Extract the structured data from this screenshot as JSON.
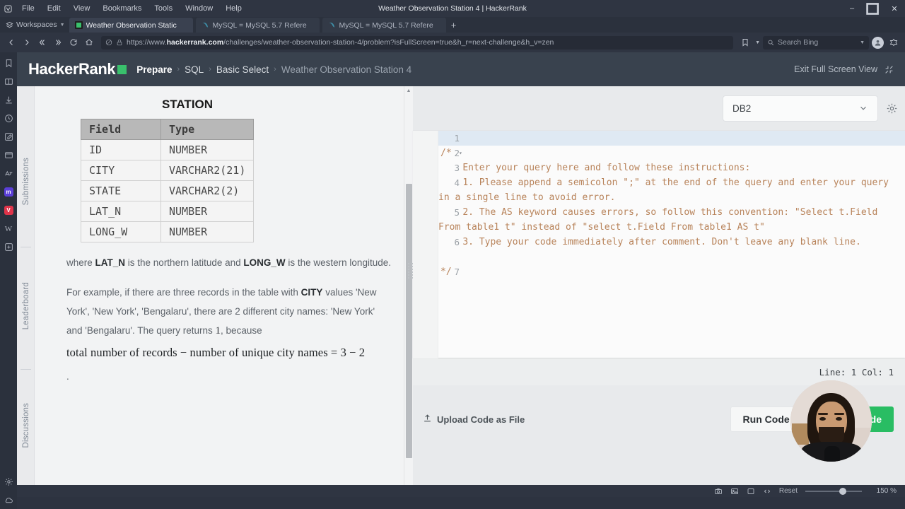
{
  "browser": {
    "menu_items": [
      "File",
      "Edit",
      "View",
      "Bookmarks",
      "Tools",
      "Window",
      "Help"
    ],
    "window_title": "Weather Observation Station 4 | HackerRank",
    "window_controls": {
      "minimize": "–",
      "maximize": "❐",
      "close": "✕"
    },
    "workspaces_label": "Workspaces",
    "tabs": [
      {
        "title": "Weather Observation Static",
        "favicon": "hackerrank-icon",
        "active": true
      },
      {
        "title": "MySQL = MySQL 5.7 Refere",
        "favicon": "mysql-icon",
        "active": false
      },
      {
        "title": "MySQL = MySQL 5.7 Refere",
        "favicon": "mysql-icon",
        "active": false
      }
    ],
    "new_tab_label": "+",
    "url_display_prefix": "https://www.",
    "url_display_domain": "hackerrank.com",
    "url_display_path": "/challenges/weather-observation-station-4/problem?isFullScreen=true&h_r=next-challenge&h_v=zen",
    "search_placeholder": "Search Bing",
    "sidepanel_icons": [
      "bookmarks-icon",
      "reading-list-icon",
      "downloads-icon",
      "history-icon",
      "notes-icon",
      "window-panel-icon",
      "translate-icon",
      "mastodon-icon",
      "vivaldi-social-icon",
      "wikipedia-icon",
      "add-panel-icon"
    ],
    "sidepanel_bottom_icons": [
      "settings-gear-icon",
      "sync-cloud-icon"
    ],
    "statusbar": {
      "icons": [
        "capture-page-icon",
        "image-toggle-icon",
        "tiling-icon",
        "developer-tools-icon"
      ],
      "reset_label": "Reset",
      "zoom_level": "150 %"
    }
  },
  "header": {
    "logo_text": "HackerRank",
    "breadcrumbs": [
      "Prepare",
      "SQL",
      "Basic Select",
      "Weather Observation Station 4"
    ],
    "breadcrumb_separator": "›",
    "exit_fullscreen_label": "Exit Full Screen View"
  },
  "vertical_tabs": [
    "Submissions",
    "Leaderboard",
    "Discussions"
  ],
  "statement": {
    "table_title": "STATION",
    "schema_headers": [
      "Field",
      "Type"
    ],
    "schema_rows": [
      [
        "ID",
        "NUMBER"
      ],
      [
        "CITY",
        "VARCHAR2(21)"
      ],
      [
        "STATE",
        "VARCHAR2(2)"
      ],
      [
        "LAT_N",
        "NUMBER"
      ],
      [
        "LONG_W",
        "NUMBER"
      ]
    ],
    "para1_pre": "where ",
    "para1_b1": "LAT_N",
    "para1_mid": " is the northern latitude and ",
    "para1_b2": "LONG_W",
    "para1_post": " is the western longitude.",
    "para2_pre": "For example, if there are three records in the table with ",
    "para2_b1": "CITY",
    "para2_mid": " values 'New York', 'New York', 'Bengalaru', there are 2 different city names: 'New York' and 'Bengalaru'. The query returns ",
    "para2_num": "1",
    "para2_post": ", because",
    "formula": "total number of records − number of unique city names = 3 − 2",
    "trailing_dot": "."
  },
  "editor": {
    "language_selected": "DB2",
    "settings_icon": "gear-icon",
    "lines": [
      {
        "num": "1",
        "fold": "",
        "text": ""
      },
      {
        "num": "2",
        "fold": "▾",
        "text": "/*"
      },
      {
        "num": "3",
        "fold": "",
        "text": "    Enter your query here and follow these instructions:"
      },
      {
        "num": "4",
        "fold": "",
        "text": "    1. Please append a semicolon \";\" at the end of the query and enter your query in a single line to avoid error."
      },
      {
        "num": "5",
        "fold": "",
        "text": "    2. The AS keyword causes errors, so follow this convention: \"Select t.Field From table1 t\" instead of \"select t.Field From table1 AS t\""
      },
      {
        "num": "6",
        "fold": "",
        "text": "    3. Type your code immediately after comment. Don't leave any blank line."
      },
      {
        "num": "7",
        "fold": "",
        "text": "*/"
      }
    ],
    "status_line": "Line: 1 Col: 1",
    "upload_label": "Upload Code as File",
    "run_label": "Run  Code",
    "submit_label": "Submit  Code"
  },
  "colors": {
    "brand_green": "#29bd63",
    "header_dark": "#39424e",
    "chrome_dark": "#2f3542",
    "code_comment": "#b8835a"
  }
}
